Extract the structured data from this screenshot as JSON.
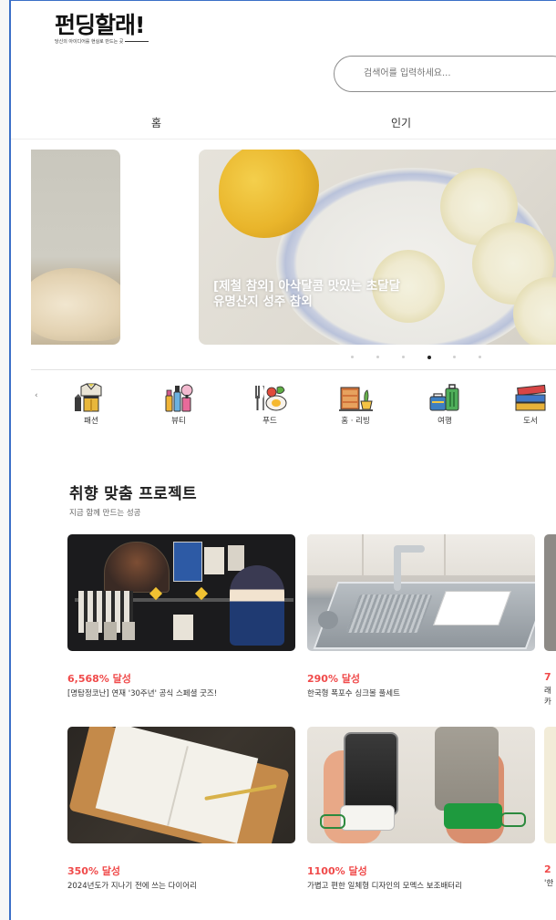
{
  "logo": {
    "text": "펀딩할래!",
    "tagline": "당신의 아이디어를 현실로 만드는 곳"
  },
  "search": {
    "placeholder": "검색어를 입력하세요..."
  },
  "nav": {
    "items": [
      {
        "label": "홈"
      },
      {
        "label": "인기"
      }
    ]
  },
  "banner": {
    "line1": "[제철 참외] 아삭달콤 맛있는 초달달",
    "line2": "유명산지 성주 참외",
    "dots_count": 6,
    "active_dot": 4
  },
  "categories": [
    {
      "label": "패션",
      "icon": "fashion-icon"
    },
    {
      "label": "뷰티",
      "icon": "beauty-icon"
    },
    {
      "label": "푸드",
      "icon": "food-icon"
    },
    {
      "label": "홈 · 리빙",
      "icon": "home-living-icon"
    },
    {
      "label": "여행",
      "icon": "travel-icon"
    },
    {
      "label": "도서",
      "icon": "books-icon"
    }
  ],
  "section": {
    "title": "취향 맞춤 프로젝트",
    "subtitle": "지금 함께 만드는 성공"
  },
  "projects": [
    {
      "pct": "6,568% 달성",
      "title": "[명탐정코난] 연재 '30주년' 공식 스페셜 굿즈!"
    },
    {
      "pct": "290% 달성",
      "title": "한국형 폭포수 싱크볼 풀세트"
    },
    {
      "pct": "350% 달성",
      "title": "2024년도가 지나기 전에 쓰는 다이어리"
    },
    {
      "pct": "1100% 달성",
      "title": "가볍고 편한 일체형 디자인의 모멕스 보조배터리"
    }
  ],
  "edge_cards": [
    {
      "pct": "7",
      "title": "래",
      "title2": "카"
    },
    {
      "pct": "2",
      "title": "'한"
    }
  ],
  "colors": {
    "accent_red": "#f04a4a",
    "frame_blue": "#3b6fc7"
  }
}
